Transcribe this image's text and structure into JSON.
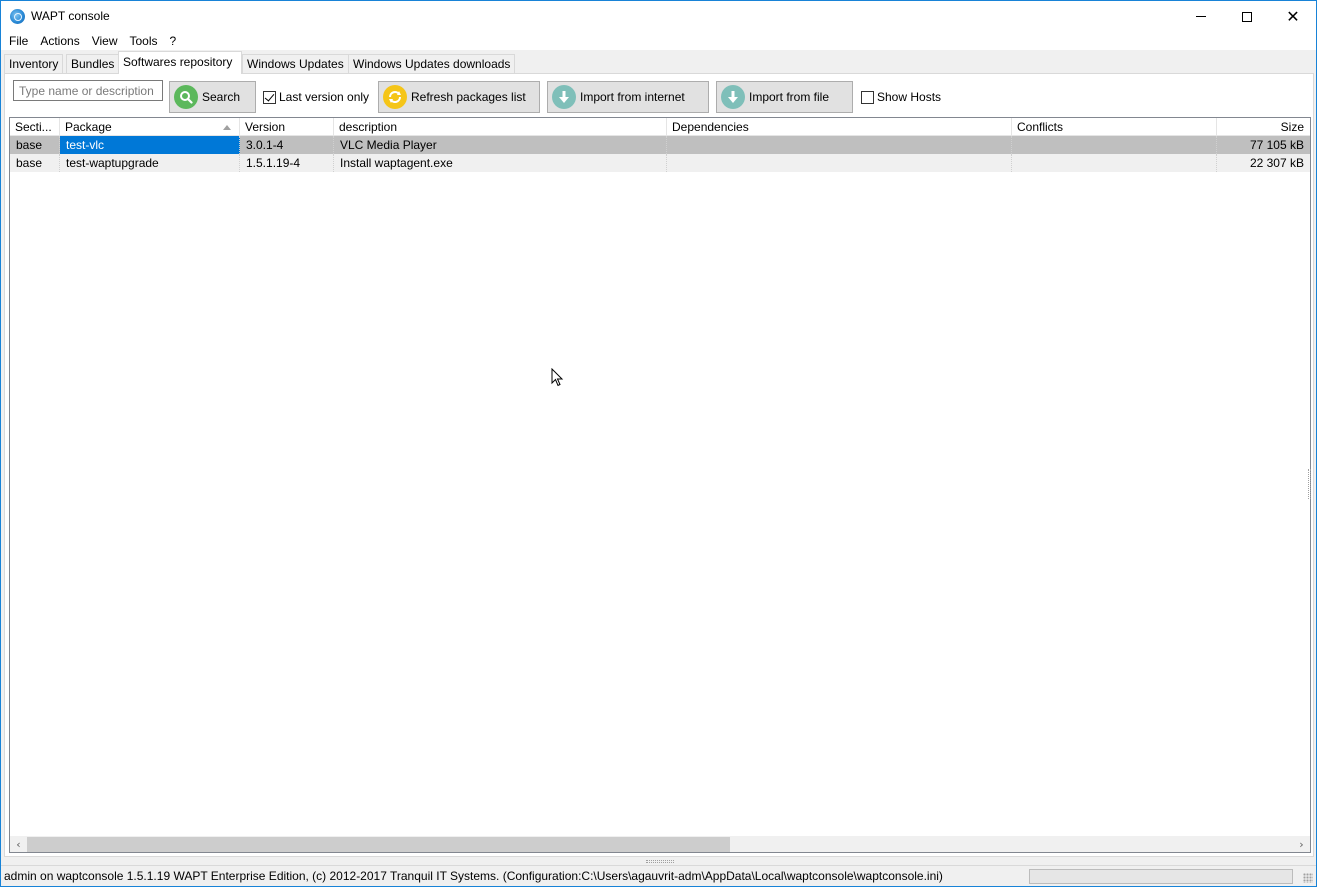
{
  "window": {
    "title": "WAPT console",
    "controls": {
      "minimize": "minimize",
      "maximize": "maximize",
      "close": "✕"
    }
  },
  "menu": [
    "File",
    "Actions",
    "View",
    "Tools",
    "?"
  ],
  "tabs": [
    {
      "label": "Inventory",
      "active": false
    },
    {
      "label": "Bundles",
      "active": false
    },
    {
      "label": "Softwares repository",
      "active": true
    },
    {
      "label": "Windows Updates",
      "active": false
    },
    {
      "label": "Windows Updates downloads",
      "active": false
    }
  ],
  "toolbar": {
    "search_placeholder": "Type name or description",
    "search_value": "",
    "search_label": "Search",
    "search_icon": "magnifier-icon",
    "last_version_only": {
      "label": "Last version only",
      "checked": true
    },
    "refresh_label": "Refresh packages list",
    "refresh_icon": "refresh-icon",
    "import_internet_label": "Import from internet",
    "import_file_label": "Import from file",
    "import_icon": "download-arrow-icon",
    "show_hosts": {
      "label": "Show Hosts",
      "checked": false
    }
  },
  "grid": {
    "columns": [
      "Secti...",
      "Package",
      "Version",
      "description",
      "Dependencies",
      "Conflicts",
      "Size"
    ],
    "sort_column": "Package",
    "sort_direction": "ascending",
    "rows": [
      {
        "section": "base",
        "package": "test-vlc",
        "version": "3.0.1-4",
        "description": "VLC Media Player",
        "dependencies": "",
        "conflicts": "",
        "size": "77 105 kB",
        "selected": true
      },
      {
        "section": "base",
        "package": "test-waptupgrade",
        "version": "1.5.1.19-4",
        "description": "Install waptagent.exe",
        "dependencies": "",
        "conflicts": "",
        "size": "22 307 kB",
        "selected": false
      }
    ],
    "scroll_left": "‹",
    "scroll_right": "›"
  },
  "status": {
    "text": "admin on waptconsole 1.5.1.19 WAPT Enterprise Edition, (c) 2012-2017 Tranquil IT Systems. (Configuration:C:\\Users\\agauvrit-adm\\AppData\\Local\\waptconsole\\waptconsole.ini)",
    "progress": 0
  },
  "colors": {
    "selection": "#0078d7",
    "selected_row": "#bfbfbf",
    "alt_row": "#f0f0f0",
    "window_border": "#1883d7",
    "search_icon_bg": "#5cb85c",
    "refresh_icon_bg": "#f5c518",
    "import_icon_bg": "#7fbfb9"
  }
}
